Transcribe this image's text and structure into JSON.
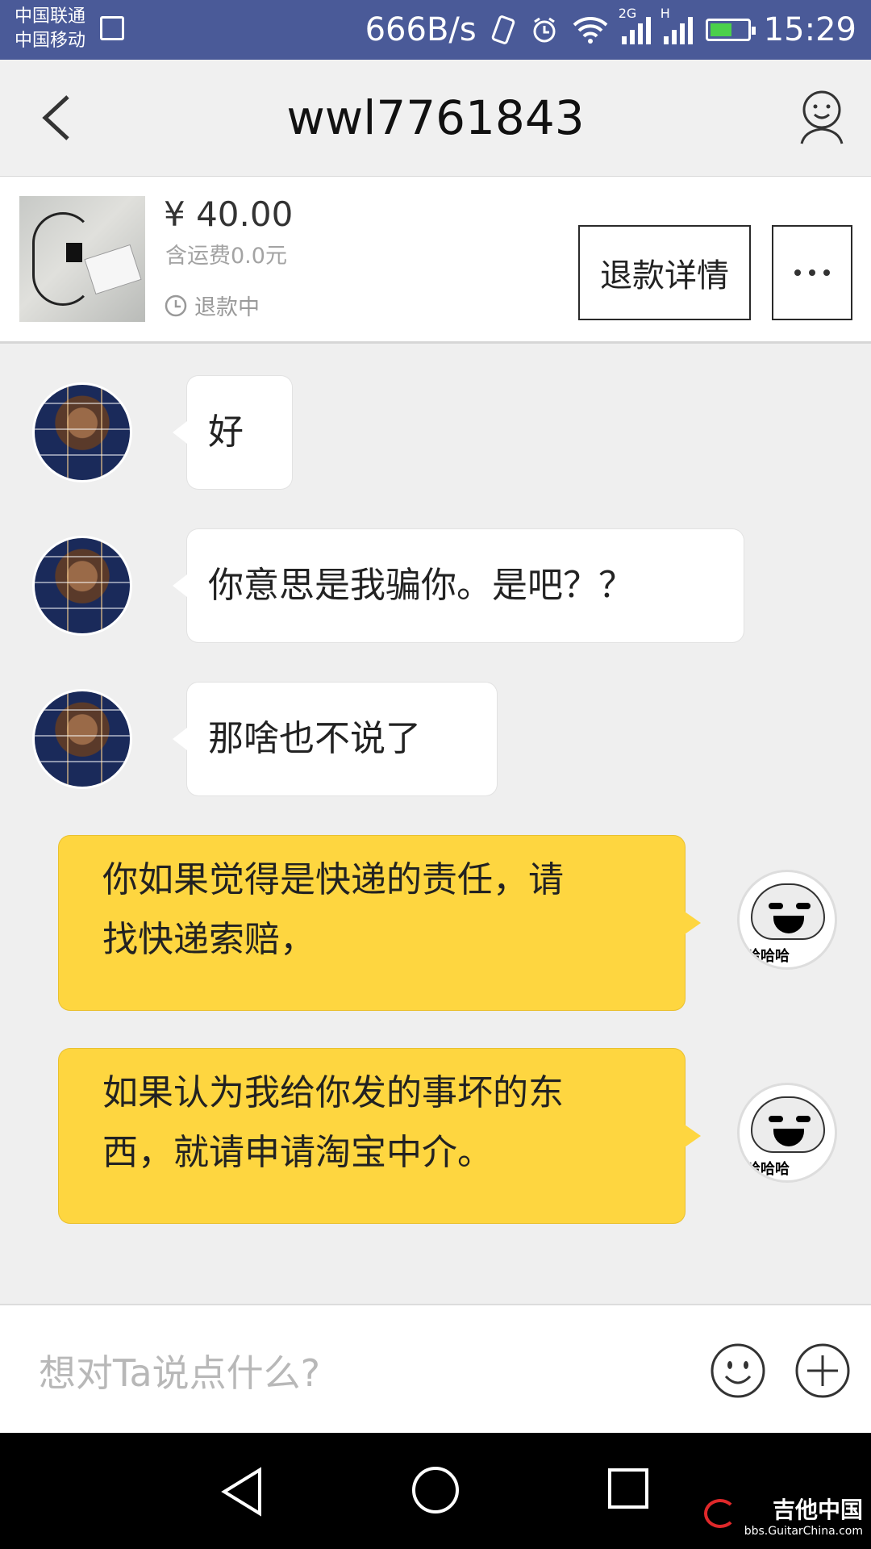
{
  "status_bar": {
    "carrier_1": "中国联通",
    "carrier_2": "中国移动",
    "speed": "666B/s",
    "net_2g": "2G",
    "net_h": "H",
    "time": "15:29"
  },
  "header": {
    "title": "wwl7761843",
    "back_icon": "chevron-left-icon",
    "profile_icon": "user-profile-icon"
  },
  "order": {
    "price": "¥ 40.00",
    "shipping": "含运费0.0元",
    "status": "退款中",
    "refund_button": "退款详情",
    "more_icon": "more-dots-icon"
  },
  "messages": [
    {
      "sender": "other",
      "text": "好"
    },
    {
      "sender": "other",
      "text": "你意思是我骗你。是吧？？"
    },
    {
      "sender": "other",
      "text": "那啥也不说了"
    },
    {
      "sender": "self",
      "line1": "你如果觉得是快递的责任，请",
      "line2": "找快递索赔，"
    },
    {
      "sender": "self",
      "line1": "如果认为我给你发的事坏的东",
      "line2": "西，就请申请淘宝中介。"
    }
  ],
  "self_avatar_text": "哈哈哈",
  "input": {
    "placeholder": "想对Ta说点什么?",
    "emoji_icon": "emoji-icon",
    "plus_icon": "plus-icon"
  },
  "watermark": {
    "title": "吉他中国",
    "url": "bbs.GuitarChina.com"
  },
  "colors": {
    "status_bar": "#4a5a98",
    "self_bubble": "#fed640",
    "other_bubble": "#ffffff",
    "chat_bg": "#efefef"
  }
}
